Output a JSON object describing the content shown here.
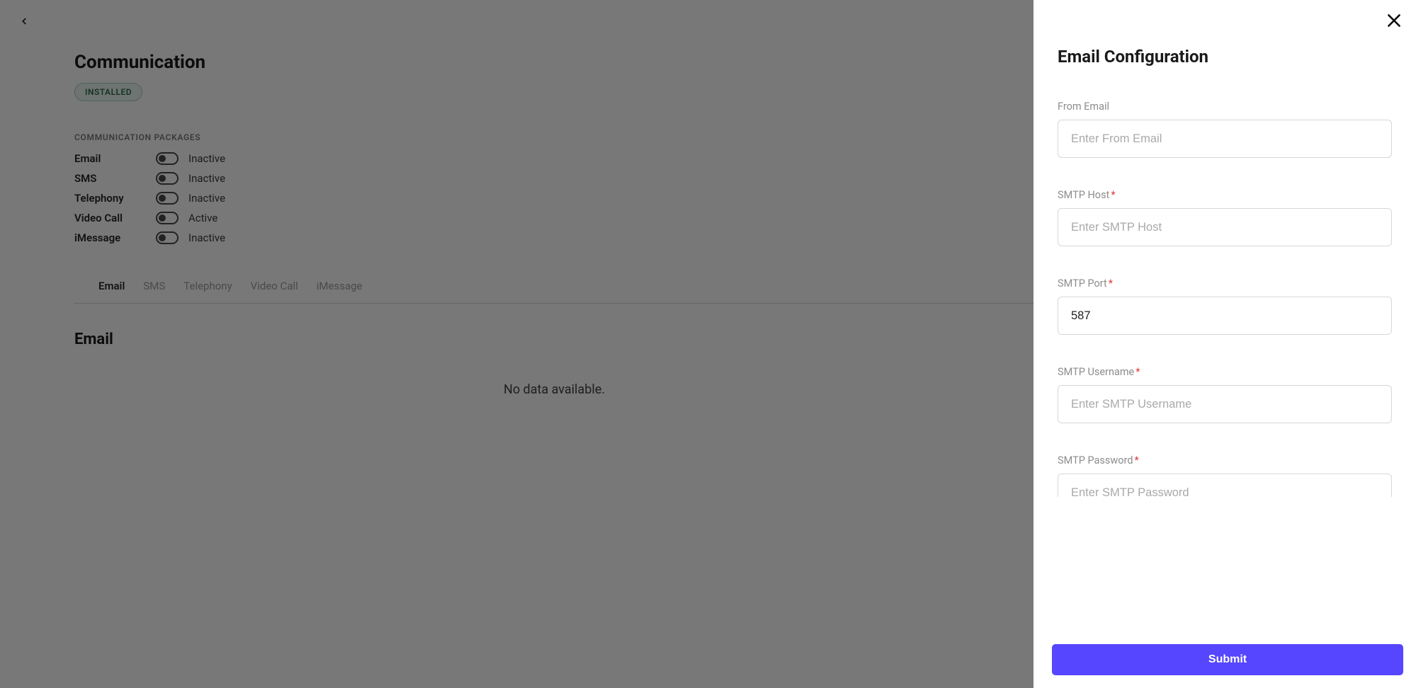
{
  "page": {
    "title": "Communication",
    "badge": "INSTALLED",
    "section_label": "COMMUNICATION PACKAGES",
    "packages": [
      {
        "name": "Email",
        "status": "Inactive"
      },
      {
        "name": "SMS",
        "status": "Inactive"
      },
      {
        "name": "Telephony",
        "status": "Inactive"
      },
      {
        "name": "Video Call",
        "status": "Active"
      },
      {
        "name": "iMessage",
        "status": "Inactive"
      }
    ],
    "tabs": [
      "Email",
      "SMS",
      "Telephony",
      "Video Call",
      "iMessage"
    ],
    "active_tab": "Email",
    "subheading": "Email",
    "empty_text": "No data available."
  },
  "panel": {
    "title": "Email Configuration",
    "fields": {
      "from_email": {
        "label": "From Email",
        "required": false,
        "placeholder": "Enter From Email",
        "value": ""
      },
      "smtp_host": {
        "label": "SMTP Host",
        "required": true,
        "placeholder": "Enter SMTP Host",
        "value": ""
      },
      "smtp_port": {
        "label": "SMTP Port",
        "required": true,
        "placeholder": "",
        "value": "587"
      },
      "smtp_user": {
        "label": "SMTP Username",
        "required": true,
        "placeholder": "Enter SMTP Username",
        "value": ""
      },
      "smtp_pass": {
        "label": "SMTP Password",
        "required": true,
        "placeholder": "Enter SMTP Password",
        "value": ""
      }
    },
    "submit_label": "Submit"
  }
}
